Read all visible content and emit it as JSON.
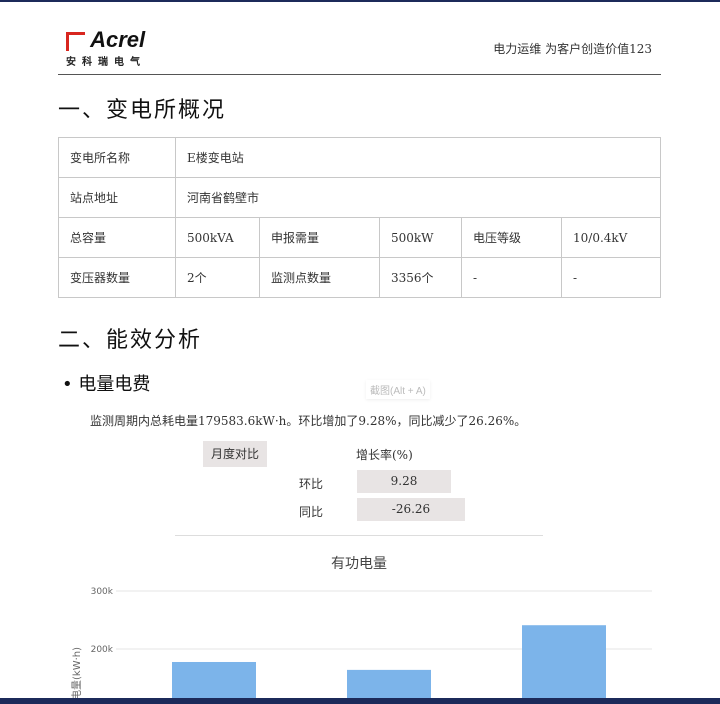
{
  "header": {
    "logo_word": "Acrel",
    "logo_cn": "安科瑞电气",
    "slogan": "电力运维 为客户创造价值123"
  },
  "section1": {
    "title": "一、变电所概况"
  },
  "info_table": {
    "rows": [
      [
        "变电所名称",
        "E楼变电站"
      ],
      [
        "站点地址",
        "河南省鹤壁市"
      ],
      [
        "总容量",
        "500kVA",
        "申报需量",
        "500kW",
        "电压等级",
        "10/0.4kV"
      ],
      [
        "变压器数量",
        "2个",
        "监测点数量",
        "3356个",
        "-",
        "-"
      ]
    ]
  },
  "section2": {
    "title": "二、能效分析"
  },
  "subsection": {
    "title": "• 电量电费"
  },
  "tooltip": "截图(Alt + A)",
  "summary": "监测周期内总耗电量179583.6kW·h。环比增加了9.28%，同比减少了26.26%。",
  "comparison": {
    "header_left": "月度对比",
    "header_right": "增长率(%)",
    "rows": [
      {
        "label": "环比",
        "value": "9.28"
      },
      {
        "label": "同比",
        "value": "-26.26"
      }
    ]
  },
  "chart_data": {
    "type": "bar",
    "title": "有功电量",
    "ylabel": "电量(kW·h)",
    "yticks": [
      "300k",
      "200k"
    ],
    "ylim": [
      0,
      300000
    ],
    "values": [
      177600,
      164000,
      241000
    ],
    "bar_color": "#7cb4ea",
    "grid": true
  }
}
